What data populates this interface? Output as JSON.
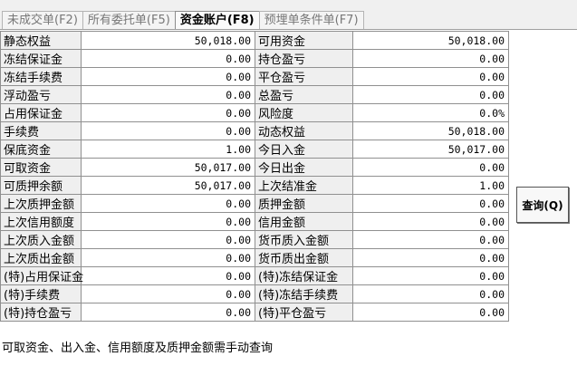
{
  "tabs": [
    {
      "label": "未成交单(F2)"
    },
    {
      "label": "所有委托单(F5)"
    },
    {
      "label": "资金账户(F8)"
    },
    {
      "label": "预埋单条件单(F7)"
    }
  ],
  "active_tab": 2,
  "rows": [
    {
      "l1": "静态权益",
      "v1": "50,018.00",
      "l2": "可用资金",
      "v2": "50,018.00"
    },
    {
      "l1": "冻结保证金",
      "v1": "0.00",
      "l2": "持仓盈亏",
      "v2": "0.00"
    },
    {
      "l1": "冻结手续费",
      "v1": "0.00",
      "l2": "平仓盈亏",
      "v2": "0.00"
    },
    {
      "l1": "浮动盈亏",
      "v1": "0.00",
      "l2": "总盈亏",
      "v2": "0.00"
    },
    {
      "l1": "占用保证金",
      "v1": "0.00",
      "l2": "风险度",
      "v2": "0.0%"
    },
    {
      "l1": "手续费",
      "v1": "0.00",
      "l2": "动态权益",
      "v2": "50,018.00"
    },
    {
      "l1": "保底资金",
      "v1": "1.00",
      "l2": "今日入金",
      "v2": "50,017.00"
    },
    {
      "l1": "可取资金",
      "v1": "50,017.00",
      "l2": "今日出金",
      "v2": "0.00"
    },
    {
      "l1": "可质押余额",
      "v1": "50,017.00",
      "l2": "上次结准金",
      "v2": "1.00"
    },
    {
      "l1": "上次质押金额",
      "v1": "0.00",
      "l2": "质押金额",
      "v2": "0.00"
    },
    {
      "l1": "上次信用额度",
      "v1": "0.00",
      "l2": "信用金额",
      "v2": "0.00"
    },
    {
      "l1": "上次质入金额",
      "v1": "0.00",
      "l2": "货币质入金额",
      "v2": "0.00"
    },
    {
      "l1": "上次质出金额",
      "v1": "0.00",
      "l2": "货币质出金额",
      "v2": "0.00"
    },
    {
      "l1": "(特)占用保证金",
      "v1": "0.00",
      "l2": "(特)冻结保证金",
      "v2": "0.00"
    },
    {
      "l1": "(特)手续费",
      "v1": "0.00",
      "l2": "(特)冻结手续费",
      "v2": "0.00"
    },
    {
      "l1": "(特)持仓盈亏",
      "v1": "0.00",
      "l2": "(特)平仓盈亏",
      "v2": "0.00"
    }
  ],
  "query_button": "查询(Q)",
  "note": "可取资金、出入金、信用额度及质押金额需手动查询"
}
